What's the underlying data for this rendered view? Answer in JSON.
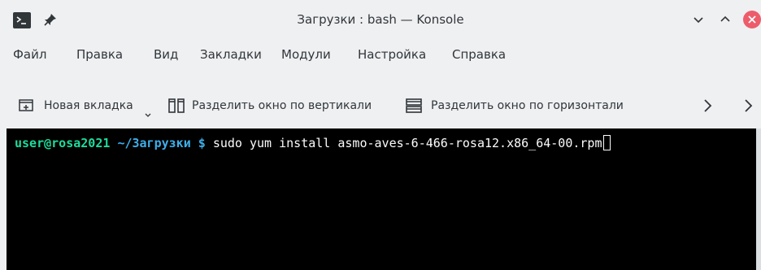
{
  "window": {
    "title": "Загрузки : bash — Konsole"
  },
  "menu": {
    "items": [
      "Файл",
      "Правка",
      "Вид",
      "Закладки",
      "Модули",
      "Настройка",
      "Справка"
    ]
  },
  "toolbar": {
    "new_tab": "Новая вкладка",
    "split_vertical": "Разделить окно по вертикали",
    "split_horizontal": "Разделить окно по горизонтали"
  },
  "terminal": {
    "prompt_user": "user@rosa2021",
    "prompt_path": "~/Загрузки",
    "prompt_symbol": "$",
    "command": "sudo yum install asmo-aves-6-466-rosa12.x86_64-00.rpm"
  },
  "colors": {
    "prompt_user": "#1cdc9a",
    "prompt_path": "#3daee9",
    "terminal_bg": "#000000",
    "close_button": "#ed5c6a"
  }
}
